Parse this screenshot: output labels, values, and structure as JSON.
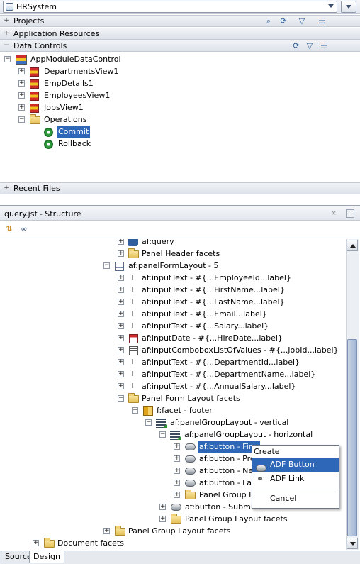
{
  "app_navigator": {
    "application": "HRSystem",
    "sections": {
      "projects": "Projects",
      "application_resources": "Application Resources",
      "data_controls": "Data Controls",
      "recent_files": "Recent Files"
    },
    "expander_collapsed": "+",
    "expander_expanded": "−"
  },
  "data_controls_tree": {
    "root": "AppModuleDataControl",
    "items": [
      "DepartmentsView1",
      "EmpDetails1",
      "EmployeesView1",
      "JobsView1"
    ],
    "operations_folder": "Operations",
    "operations": [
      "Commit",
      "Rollback"
    ],
    "selected": "Commit"
  },
  "structure": {
    "title": "query.jsf - Structure",
    "close_glyph": "×",
    "nodes": [
      "af:query",
      "Panel Header facets",
      "af:panelFormLayout - 5",
      "af:inputText - #{...EmployeeId...label}",
      "af:inputText - #{...FirstName...label}",
      "af:inputText - #{...LastName...label}",
      "af:inputText - #{...Email...label}",
      "af:inputText - #{...Salary...label}",
      "af:inputDate - #{...HireDate...label}",
      "af:inputComboboxListOfValues - #{...JobId...label}",
      "af:inputText - #{...DepartmentId...label}",
      "af:inputText - #{...DepartmentName...label}",
      "af:inputText - #{...AnnualSalary...label}",
      "Panel Form Layout facets",
      "f:facet - footer",
      "af:panelGroupLayout - vertical",
      "af:panelGroupLayout - horizontal",
      "af:button - First",
      "af:button - Pre",
      "af:button - Nex",
      "af:button - Las",
      "Panel Group La",
      "af:button - Submit",
      "Panel Group Layout facets",
      "Panel Group Layout facets",
      "Document facets"
    ]
  },
  "context_menu": {
    "header": "Create",
    "items": [
      {
        "label": "ADF Button",
        "icon": "button-icon",
        "highlighted": true
      },
      {
        "label": "ADF Link",
        "icon": "link-icon",
        "highlighted": false
      },
      {
        "label": "Cancel",
        "icon": "",
        "highlighted": false
      }
    ]
  },
  "bottom_tabs": [
    "Source",
    "Design"
  ],
  "active_tab": "Design",
  "colors": {
    "selection": "#2f67b8",
    "panel_header": "#e3e7ee",
    "border": "#9aa3b0"
  }
}
